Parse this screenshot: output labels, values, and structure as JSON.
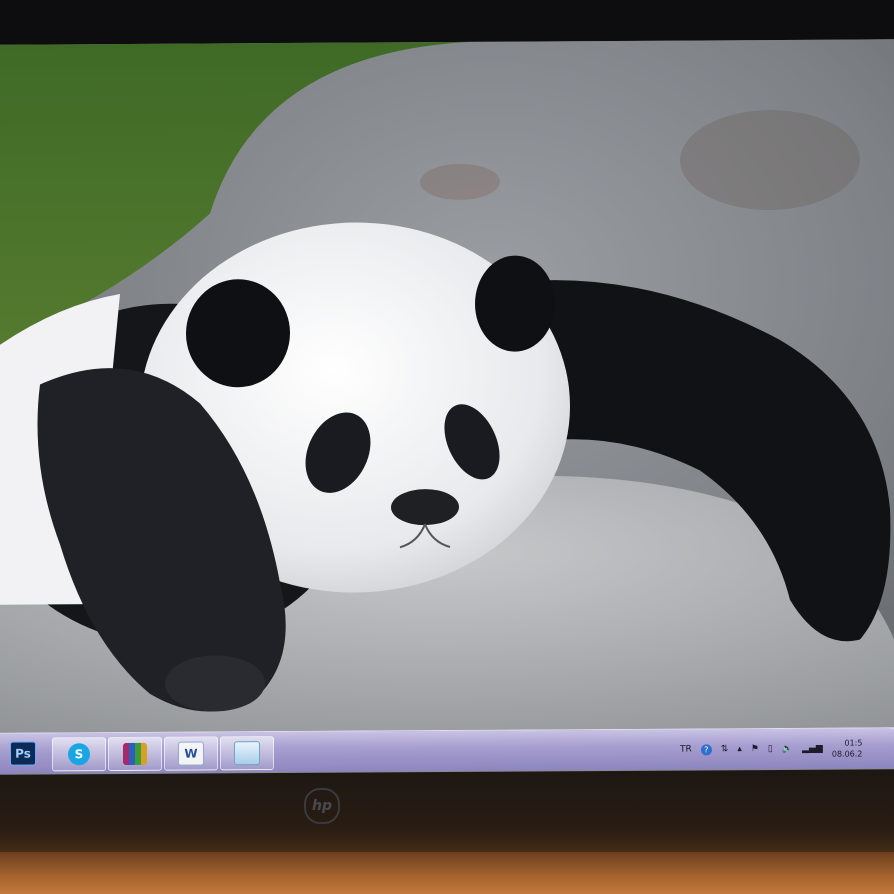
{
  "taskbar": {
    "apps": [
      {
        "name": "Photoshop",
        "icon": "photoshop-icon",
        "label": "Ps"
      },
      {
        "name": "Skype",
        "icon": "skype-icon",
        "label": "S"
      },
      {
        "name": "WinRAR",
        "icon": "winrar-icon",
        "label": ""
      },
      {
        "name": "Word",
        "icon": "word-icon",
        "label": "W"
      },
      {
        "name": "Explorer",
        "icon": "folder-icon",
        "label": ""
      }
    ],
    "tray": {
      "language": "TR",
      "time": "01:5",
      "date": "08.06.2"
    },
    "colors": {
      "taskbar": "#a79fd0"
    }
  },
  "monitor": {
    "brand_logo": "hp"
  },
  "wallpaper": {
    "subject": "panda-icon"
  }
}
